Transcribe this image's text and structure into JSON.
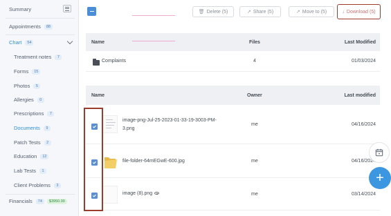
{
  "sidebar": {
    "summary": "Summary",
    "appointments": {
      "label": "Appointments",
      "count": "88"
    },
    "chart": {
      "label": "Chart",
      "count": "54"
    },
    "items": [
      {
        "label": "Treatment notes",
        "count": "7"
      },
      {
        "label": "Forms",
        "count": "15"
      },
      {
        "label": "Photos",
        "count": "5"
      },
      {
        "label": "Allergies",
        "count": "0"
      },
      {
        "label": "Prescriptions",
        "count": "7"
      },
      {
        "label": "Documents",
        "count": "9"
      },
      {
        "label": "Patch Tests",
        "count": "2"
      },
      {
        "label": "Education",
        "count": "12"
      },
      {
        "label": "Lab Tests",
        "count": "1"
      },
      {
        "label": "Client Problems",
        "count": "3"
      }
    ],
    "financials": {
      "label": "Financials",
      "count": "74",
      "amount": "$3950.00"
    }
  },
  "toolbar": {
    "delete": "Delete (5)",
    "share": "Share (5)",
    "move": "Move to (5)",
    "download": "Download (5)"
  },
  "folders_table": {
    "headers": {
      "name": "Name",
      "files": "Files",
      "modified": "Last Modified"
    },
    "rows": [
      {
        "name": "Complaints",
        "files": "4",
        "modified": "01/03/2024"
      }
    ]
  },
  "files_table": {
    "headers": {
      "name": "Name",
      "owner": "Owner",
      "modified": "Last modified"
    },
    "rows": [
      {
        "name_line1": "image-png-Jul-25-2023-01-33-19-3003-PM-",
        "name_line2": "3.png",
        "owner": "me",
        "modified": "04/16/2024"
      },
      {
        "name": "file-folder-64mEGwE-600.jpg",
        "owner": "me",
        "modified": "04/16/2024"
      },
      {
        "name": "image (8).png",
        "owner": "me",
        "modified": "03/14/2024"
      }
    ]
  },
  "colors": {
    "accent": "#3d97e0",
    "highlight": "#9b3b2b",
    "sidebar_bg": "#f6f7fa",
    "header_bg": "#eef0f3"
  }
}
